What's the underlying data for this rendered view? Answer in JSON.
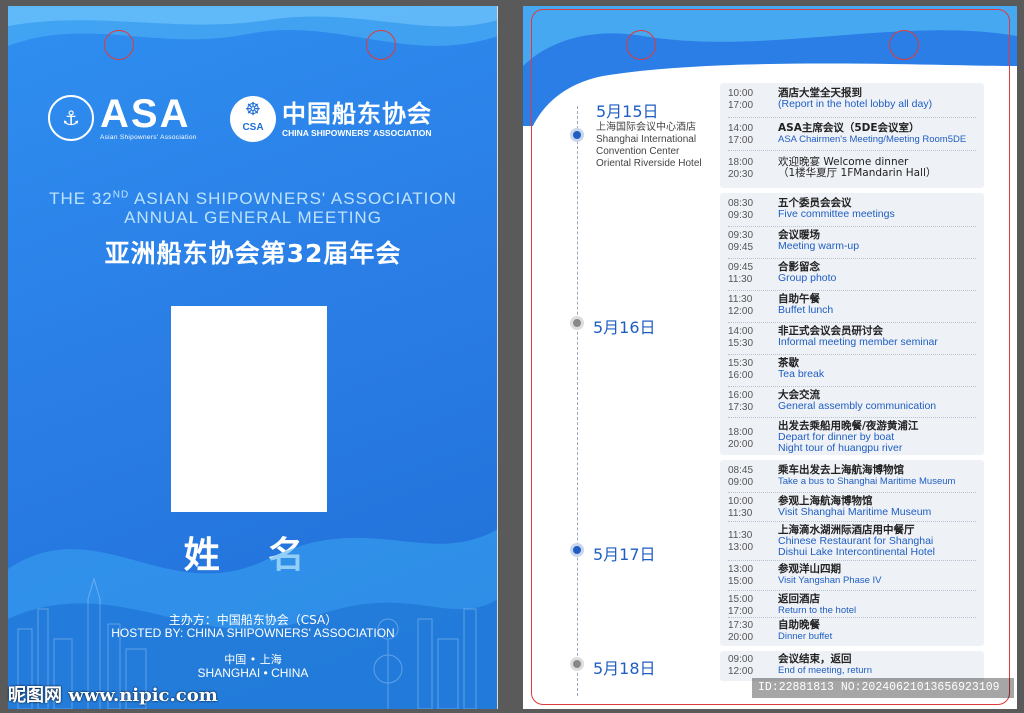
{
  "colors": {
    "card_blue": "#2a7ee6",
    "accent_blue": "#1f5ec2",
    "hole_red": "#e03a3a"
  },
  "left": {
    "asa_logo": {
      "text": "ASA",
      "sub": "Asian Shipowners' Association",
      "icon": "anchor-seal-icon"
    },
    "csa_logo": {
      "cn": "中国船东协会",
      "en": "CHINA SHIPOWNERS' ASSOCIATION",
      "seal_text": "CSA",
      "icon": "ship-wheel-icon"
    },
    "meeting_en_line1_a": "THE 32",
    "meeting_en_sup": "ND",
    "meeting_en_line1_b": " ASIAN SHIPOWNERS'  ASSOCIATION",
    "meeting_en_line2": "ANNUAL GENERAL MEETING",
    "meeting_cn": "亚洲船东协会第32届年会",
    "name_label": "姓 名",
    "host_cn": "主办方：中国船东协会（CSA）",
    "host_en": "HOSTED BY: CHINA SHIPOWNERS' ASSOCIATION",
    "city_cn": "中国 • 上海",
    "city_en": "SHANGHAI • CHINA"
  },
  "right": {
    "days": [
      {
        "label": "5月15日"
      },
      {
        "label": "5月16日"
      },
      {
        "label": "5月17日"
      },
      {
        "label": "5月18日"
      }
    ],
    "venue": [
      "上海国际会议中心酒店",
      "Shanghai International",
      "Convention Center",
      "Oriental Riverside Hotel"
    ],
    "blocks": [
      {
        "items": [
          {
            "start": "10:00",
            "end": "17:00",
            "cn": "酒店大堂全天报到",
            "en": "(Report in the hotel lobby all day)"
          },
          {
            "start": "14:00",
            "end": "17:00",
            "cn": "ASA主席会议（5DE会议室）",
            "en": "ASA Chairmen's Meeting/Meeting Room5DE"
          },
          {
            "start": "18:00",
            "end": "20:30",
            "cn": "欢迎晚宴 Welcome dinner",
            "en": "（1楼华夏厅 1FMandarin Hall）"
          }
        ]
      },
      {
        "items": [
          {
            "start": "08:30",
            "end": "09:30",
            "cn": "五个委员会会议",
            "en": "Five committee meetings"
          },
          {
            "start": "09:30",
            "end": "09:45",
            "cn": "会议暖场",
            "en": "Meeting warm-up"
          },
          {
            "start": "09:45",
            "end": "11:30",
            "cn": "合影留念",
            "en": "Group photo"
          },
          {
            "start": "11:30",
            "end": "12:00",
            "cn": "自助午餐",
            "en": "Buffet lunch"
          },
          {
            "start": "14:00",
            "end": "15:30",
            "cn": "非正式会议会员研讨会",
            "en": "Informal meeting member seminar"
          },
          {
            "start": "15:30",
            "end": "16:00",
            "cn": "茶歇",
            "en": "Tea break"
          },
          {
            "start": "16:00",
            "end": "17:30",
            "cn": "大会交流",
            "en": "General assembly communication"
          },
          {
            "start": "18:00",
            "end": "20:00",
            "cn": "出发去乘船用晚餐/夜游黄浦江",
            "en": "Depart for dinner by boat",
            "en2": "Night tour of huangpu river"
          }
        ]
      },
      {
        "items": [
          {
            "start": "08:45",
            "end": "09:00",
            "cn": "乘车出发去上海航海博物馆",
            "en": "Take a bus to Shanghai Maritime Museum"
          },
          {
            "start": "10:00",
            "end": "11:30",
            "cn": "参观上海航海博物馆",
            "en": "Visit Shanghai Maritime Museum"
          },
          {
            "start": "11:30",
            "end": "13:00",
            "cn": "上海滴水湖洲际酒店用中餐厅",
            "en": "Chinese Restaurant for Shanghai",
            "en2": "Dishui Lake Intercontinental Hotel"
          },
          {
            "start": "13:00",
            "end": "15:00",
            "cn": "参观洋山四期",
            "en": "Visit Yangshan Phase IV"
          },
          {
            "start": "15:00",
            "end": "17:00",
            "cn": "返回酒店",
            "en": "Return to the hotel"
          },
          {
            "start": "17:30",
            "end": "20:00",
            "cn": "自助晚餐",
            "en": "Dinner buffet"
          }
        ]
      },
      {
        "items": [
          {
            "start": "09:00",
            "end": "12:00",
            "cn": "会议结束，返回",
            "en": "End of meeting, return"
          }
        ]
      }
    ]
  },
  "watermark": {
    "left": "昵图网 www.nipic.com",
    "right": "ID:22881813 NO:20240621013656923109"
  }
}
